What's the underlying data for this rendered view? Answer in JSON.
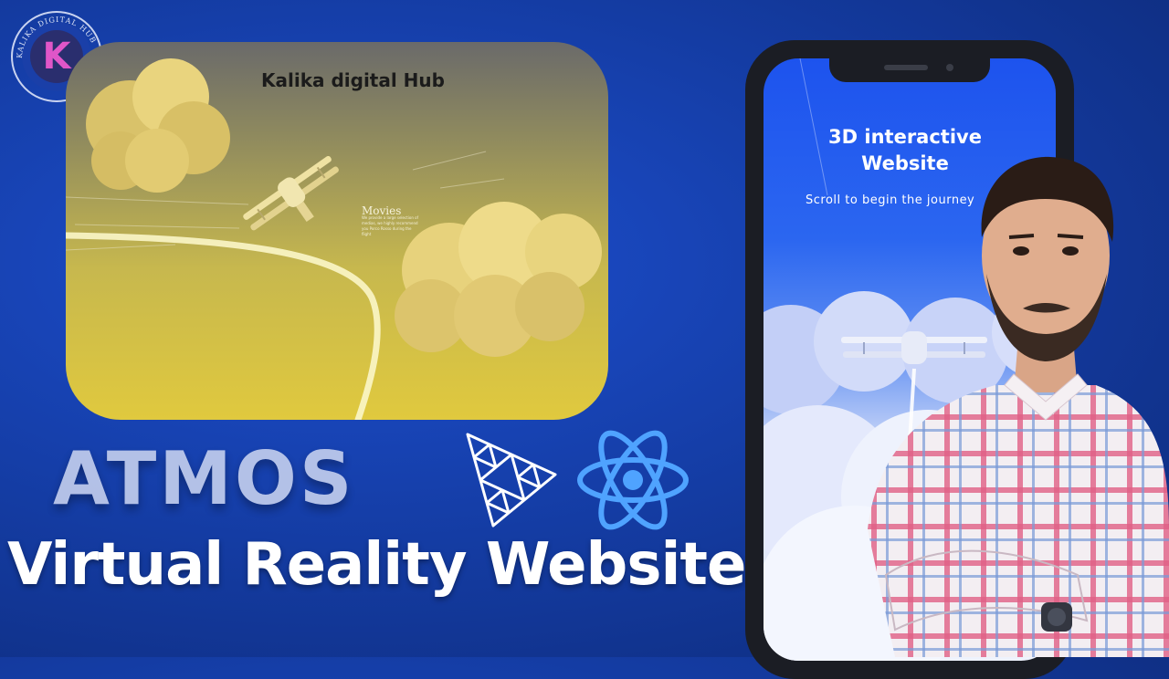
{
  "logo": {
    "text": "KALIKA DIGITAL HUB"
  },
  "preview": {
    "brand": "Kalika digital Hub",
    "movies_title": "Movies",
    "movies_body": "We provide a large selection of medias, we highly recommend you Porco Rosso during the flight"
  },
  "atmos_label": "ATMOS",
  "headline": "Virtual Reality Websites",
  "phone": {
    "title": "3D interactive Website",
    "subtitle": "Scroll to begin the journey"
  },
  "icons": {
    "threejs": "threejs-logo-icon",
    "react": "react-logo-icon"
  },
  "colors": {
    "background": "#153ea8",
    "preview_yellow": "#e0c93e",
    "phone_blue": "#1d53ee",
    "react_blue": "#4fa3ff"
  }
}
